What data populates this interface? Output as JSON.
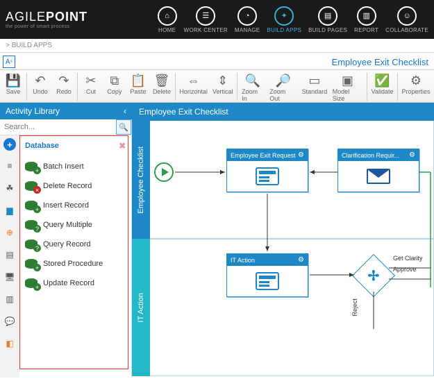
{
  "brand": {
    "name_left": "AGILE",
    "name_right": "POINT",
    "tagline": "the power of smart process"
  },
  "nav": [
    {
      "id": "home",
      "label": "HOME"
    },
    {
      "id": "workcenter",
      "label": "WORK CENTER"
    },
    {
      "id": "manage",
      "label": "MANAGE"
    },
    {
      "id": "buildapps",
      "label": "BUILD APPS",
      "active": true
    },
    {
      "id": "buildpages",
      "label": "BUILD PAGES"
    },
    {
      "id": "report",
      "label": "REPORT"
    },
    {
      "id": "collaborate",
      "label": "COLLABORATE"
    }
  ],
  "breadcrumb": "> BUILD APPS",
  "document_title": "Employee Exit Checklist",
  "toolbar": {
    "save": "Save",
    "undo": "Undo",
    "redo": "Redo",
    "cut": "Cut",
    "copy": "Copy",
    "paste": "Paste",
    "delete": "Delete",
    "horizontal": "Horizontal",
    "vertical": "Vertical",
    "zoomin": "Zoom In",
    "zoomout": "Zoom Out",
    "standard": "Standard",
    "modelsize": "Model Size",
    "validate": "Validate",
    "properties": "Properties"
  },
  "library": {
    "title": "Activity Library",
    "search_placeholder": "Search...",
    "category": "Database",
    "items": [
      {
        "label": "Batch Insert",
        "kind": "add"
      },
      {
        "label": "Delete Record",
        "kind": "del"
      },
      {
        "label": "Insert Record",
        "kind": "add"
      },
      {
        "label": "Query Multiple",
        "kind": "q"
      },
      {
        "label": "Query Record",
        "kind": "q"
      },
      {
        "label": "Stored Procedure",
        "kind": "add"
      },
      {
        "label": "Update Record",
        "kind": "add"
      }
    ]
  },
  "canvas": {
    "header": "Employee Exit Checklist",
    "lanes": [
      {
        "label": "Employee Checklist"
      },
      {
        "label": "IT Action"
      }
    ],
    "tasks": {
      "exit_request": "Employee Exit Request",
      "clarification": "Clarification Requir...",
      "it_action": "IT Action"
    },
    "edges": {
      "get_clarity": "Get Clarity",
      "approve": "Approve",
      "reject": "Reject"
    }
  }
}
